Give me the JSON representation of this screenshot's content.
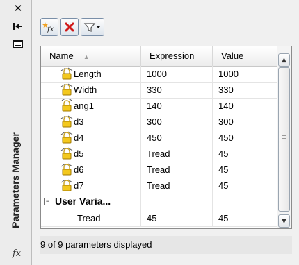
{
  "window": {
    "title": "Parameters Manager",
    "close_icon": "close-icon",
    "autohide_icon": "autohide-icon",
    "properties_icon": "properties-icon",
    "fx_symbol": "fx"
  },
  "toolbar": {
    "buttons": [
      {
        "name": "new-user-parameter-button",
        "icon": "fx-star-icon",
        "label": "fx"
      },
      {
        "name": "delete-button",
        "icon": "red-x-icon"
      },
      {
        "name": "filter-button",
        "icon": "funnel-dropdown-icon"
      }
    ]
  },
  "table": {
    "columns": [
      "Name",
      "Expression",
      "Value"
    ],
    "rows": [
      {
        "name": "Length",
        "expression": "1000",
        "value": "1000",
        "icon": "linear-constraint-icon"
      },
      {
        "name": "Width",
        "expression": "330",
        "value": "330",
        "icon": "linear-constraint-icon"
      },
      {
        "name": "ang1",
        "expression": "140",
        "value": "140",
        "icon": "angular-constraint-icon"
      },
      {
        "name": "d3",
        "expression": "300",
        "value": "300",
        "icon": "linear-constraint-icon"
      },
      {
        "name": "d4",
        "expression": "450",
        "value": "450",
        "icon": "linear-constraint-icon"
      },
      {
        "name": "d5",
        "expression": "Tread",
        "value": "45",
        "icon": "linear-constraint-icon"
      },
      {
        "name": "d6",
        "expression": "Tread",
        "value": "45",
        "icon": "linear-constraint-icon"
      },
      {
        "name": "d7",
        "expression": "Tread",
        "value": "45",
        "icon": "linear-constraint-icon"
      }
    ],
    "group": {
      "label": "User Varia...",
      "toggle": "⊟"
    },
    "user_rows": [
      {
        "name": "Tread",
        "expression": "45",
        "value": "45"
      }
    ]
  },
  "status": {
    "text": "9 of 9 parameters displayed"
  },
  "colors": {
    "accent": "#c8102e",
    "panel_bg": "#f0f0f0",
    "titlebar_bg": "#ececec"
  }
}
